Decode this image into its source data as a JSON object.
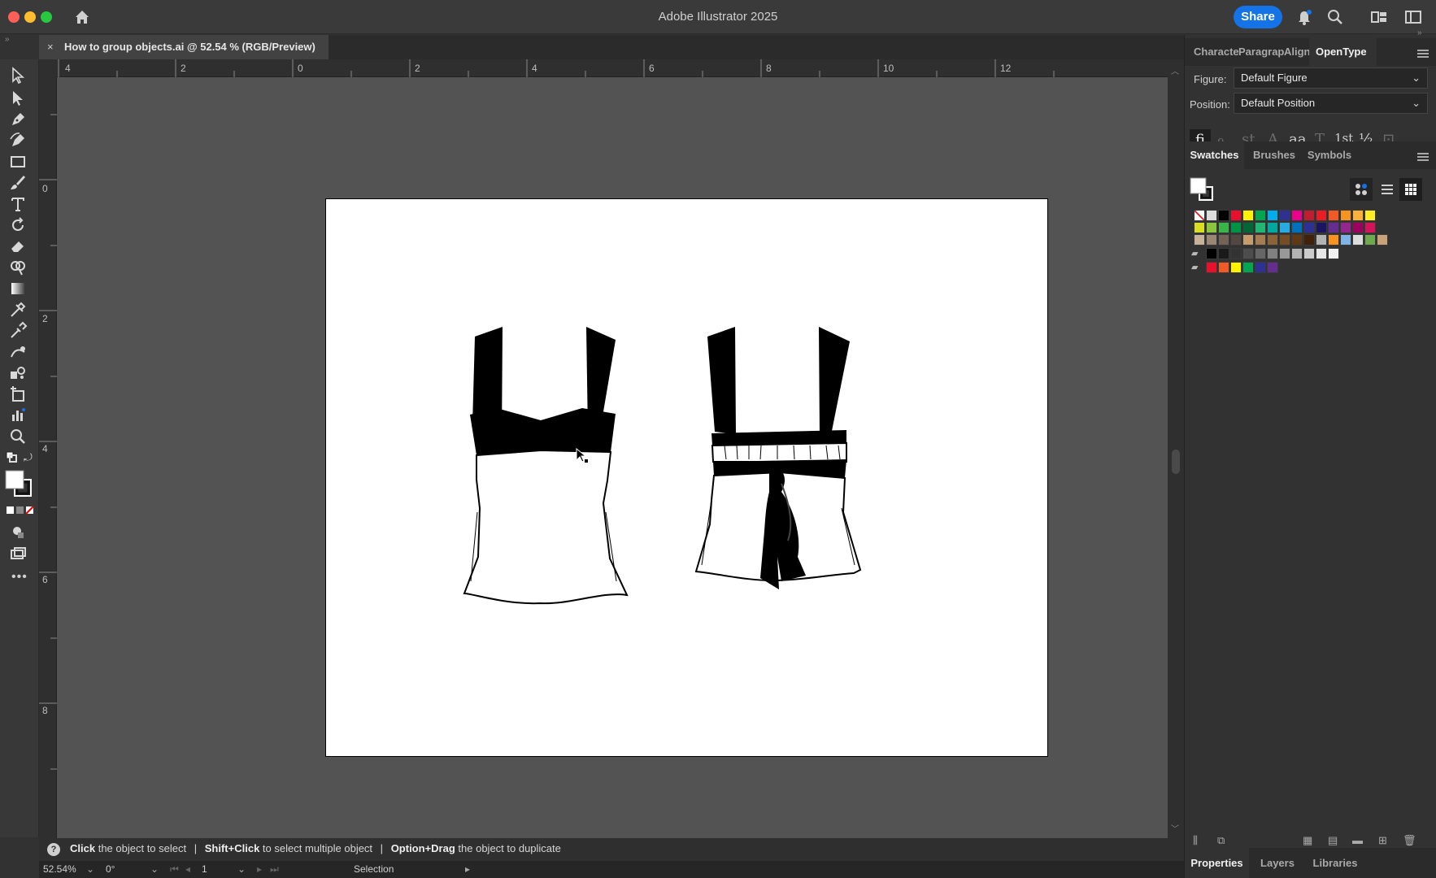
{
  "app": {
    "title": "Adobe Illustrator 2025",
    "share_label": "Share"
  },
  "document_tab": {
    "close_label": "×",
    "title": "How to group objects.ai @ 52.54 % (RGB/Preview)"
  },
  "rulers": {
    "horizontal": [
      "4",
      "2",
      "0",
      "2",
      "4",
      "6",
      "8",
      "10",
      "12"
    ],
    "vertical": [
      "0",
      "2",
      "4",
      "6",
      "8"
    ]
  },
  "tools": [
    "selection-tool",
    "direct-selection-tool",
    "pen-tool",
    "curvature-tool",
    "rectangle-tool",
    "paintbrush-tool",
    "type-tool",
    "rotate-tool",
    "eraser-tool",
    "shape-builder-tool",
    "gradient-tool",
    "eyedropper-tool",
    "blend-tool",
    "symbol-sprayer-tool",
    "artboard-tool",
    "graph-tool",
    "zoom-tool"
  ],
  "panel": {
    "top_tabs": [
      "Characte",
      "Paragrap",
      "Align",
      "OpenType"
    ],
    "active_top_tab": "OpenType",
    "figure_label": "Figure:",
    "figure_value": "Default Figure",
    "position_label": "Position:",
    "position_value": "Default Position",
    "opentype_glyphs": [
      "fi",
      "ℴ",
      "st",
      "A",
      "aa",
      "T",
      "1st",
      "½",
      "⊡"
    ],
    "swatch_tabs": [
      "Swatches",
      "Brushes",
      "Symbols"
    ],
    "active_swatch_tab": "Swatches",
    "bottom_tabs": [
      "Properties",
      "Layers",
      "Libraries"
    ],
    "active_bottom_tab": "Properties",
    "swatch_rows": [
      [
        "#e22020",
        "#ffffff",
        "#000000",
        "#e8102c",
        "#fff200",
        "#00a650",
        "#00aeef",
        "#2e3192",
        "#ec008c",
        "#be1e2d",
        "#ed1c24",
        "#f15a24",
        "#f7931e",
        "#fbb03b",
        "#fcee21"
      ],
      [
        "#d9e021",
        "#8cc63f",
        "#39b54a",
        "#009245",
        "#006837",
        "#22b573",
        "#00a99d",
        "#29abe2",
        "#0071bc",
        "#2e3192",
        "#1b1464",
        "#662d91",
        "#93278f",
        "#9e005d",
        "#d4145a"
      ],
      [
        "#c7b299",
        "#998675",
        "#736357",
        "#534741",
        "#c69c6d",
        "#a67c52",
        "#8c6239",
        "#754c24",
        "#603813",
        "#42210b",
        "#b3b3b3",
        "#f7931e",
        "#7fb2e5",
        "#dddddd",
        "#6ea94e",
        "#c9a27a"
      ],
      [
        "#000000",
        "#1a1a1a",
        "#333333",
        "#4d4d4d",
        "#666666",
        "#808080",
        "#999999",
        "#b3b3b3",
        "#cccccc",
        "#e6e6e6",
        "#f2f2f2"
      ],
      [
        "#e8102c",
        "#f15a24",
        "#fff200",
        "#00a650",
        "#2e3192",
        "#662d91"
      ]
    ]
  },
  "status": {
    "hint_1_bold": "Click",
    "hint_1": "the object to select",
    "sep": "|",
    "hint_2_bold": "Shift+Click",
    "hint_2": "to select multiple object",
    "hint_3_bold": "Option+Drag",
    "hint_3": "the object to duplicate",
    "zoom": "52.54%",
    "rotation": "0°",
    "artboard_number": "1",
    "tool_name": "Selection"
  },
  "colors": {
    "accent": "#1473e6",
    "canvas_bg": "#535353",
    "panel_bg": "#323232"
  }
}
